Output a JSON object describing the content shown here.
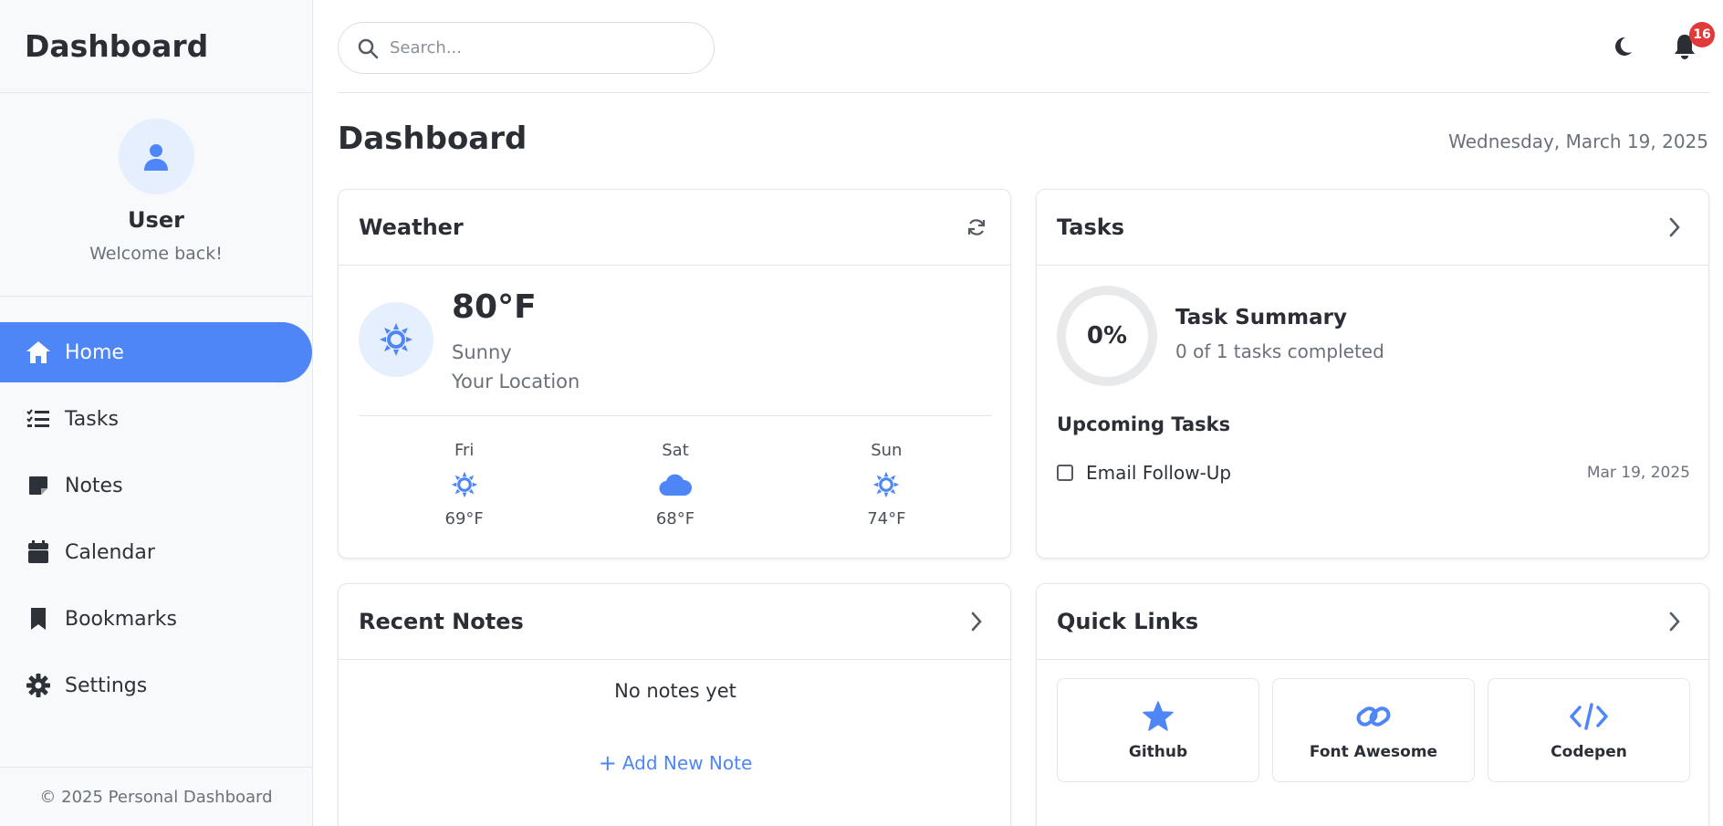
{
  "brand": "Dashboard",
  "profile": {
    "name": "User",
    "subtitle": "Welcome back!",
    "icon": "user-icon"
  },
  "nav": [
    {
      "label": "Home",
      "icon": "home-icon",
      "active": true
    },
    {
      "label": "Tasks",
      "icon": "list-check-icon"
    },
    {
      "label": "Notes",
      "icon": "note-icon"
    },
    {
      "label": "Calendar",
      "icon": "calendar-icon"
    },
    {
      "label": "Bookmarks",
      "icon": "bookmark-icon"
    },
    {
      "label": "Settings",
      "icon": "gear-icon"
    }
  ],
  "footer": "© 2025 Personal Dashboard",
  "search": {
    "placeholder": "Search..."
  },
  "notifications": {
    "count": "16"
  },
  "page": {
    "title": "Dashboard",
    "date": "Wednesday, March 19, 2025"
  },
  "weather": {
    "title": "Weather",
    "temp": "80°F",
    "condition": "Sunny",
    "location": "Your Location",
    "forecast": [
      {
        "day": "Fri",
        "icon": "sun-icon",
        "temp": "69°F"
      },
      {
        "day": "Sat",
        "icon": "cloud-icon",
        "temp": "68°F"
      },
      {
        "day": "Sun",
        "icon": "sun-icon",
        "temp": "74°F"
      }
    ]
  },
  "tasks": {
    "title": "Tasks",
    "percent": "0%",
    "summary_title": "Task Summary",
    "summary_sub": "0 of 1 tasks completed",
    "upcoming_title": "Upcoming Tasks",
    "items": [
      {
        "name": "Email Follow-Up",
        "date": "Mar 19, 2025"
      }
    ]
  },
  "notes": {
    "title": "Recent Notes",
    "empty": "No notes yet",
    "add_label": "Add New Note"
  },
  "links": {
    "title": "Quick Links",
    "items": [
      {
        "label": "Github",
        "icon": "star-icon"
      },
      {
        "label": "Font Awesome",
        "icon": "link-icon"
      },
      {
        "label": "Codepen",
        "icon": "code-icon"
      }
    ]
  },
  "colors": {
    "accent": "#4f86f7",
    "badge": "#e03a3a"
  }
}
